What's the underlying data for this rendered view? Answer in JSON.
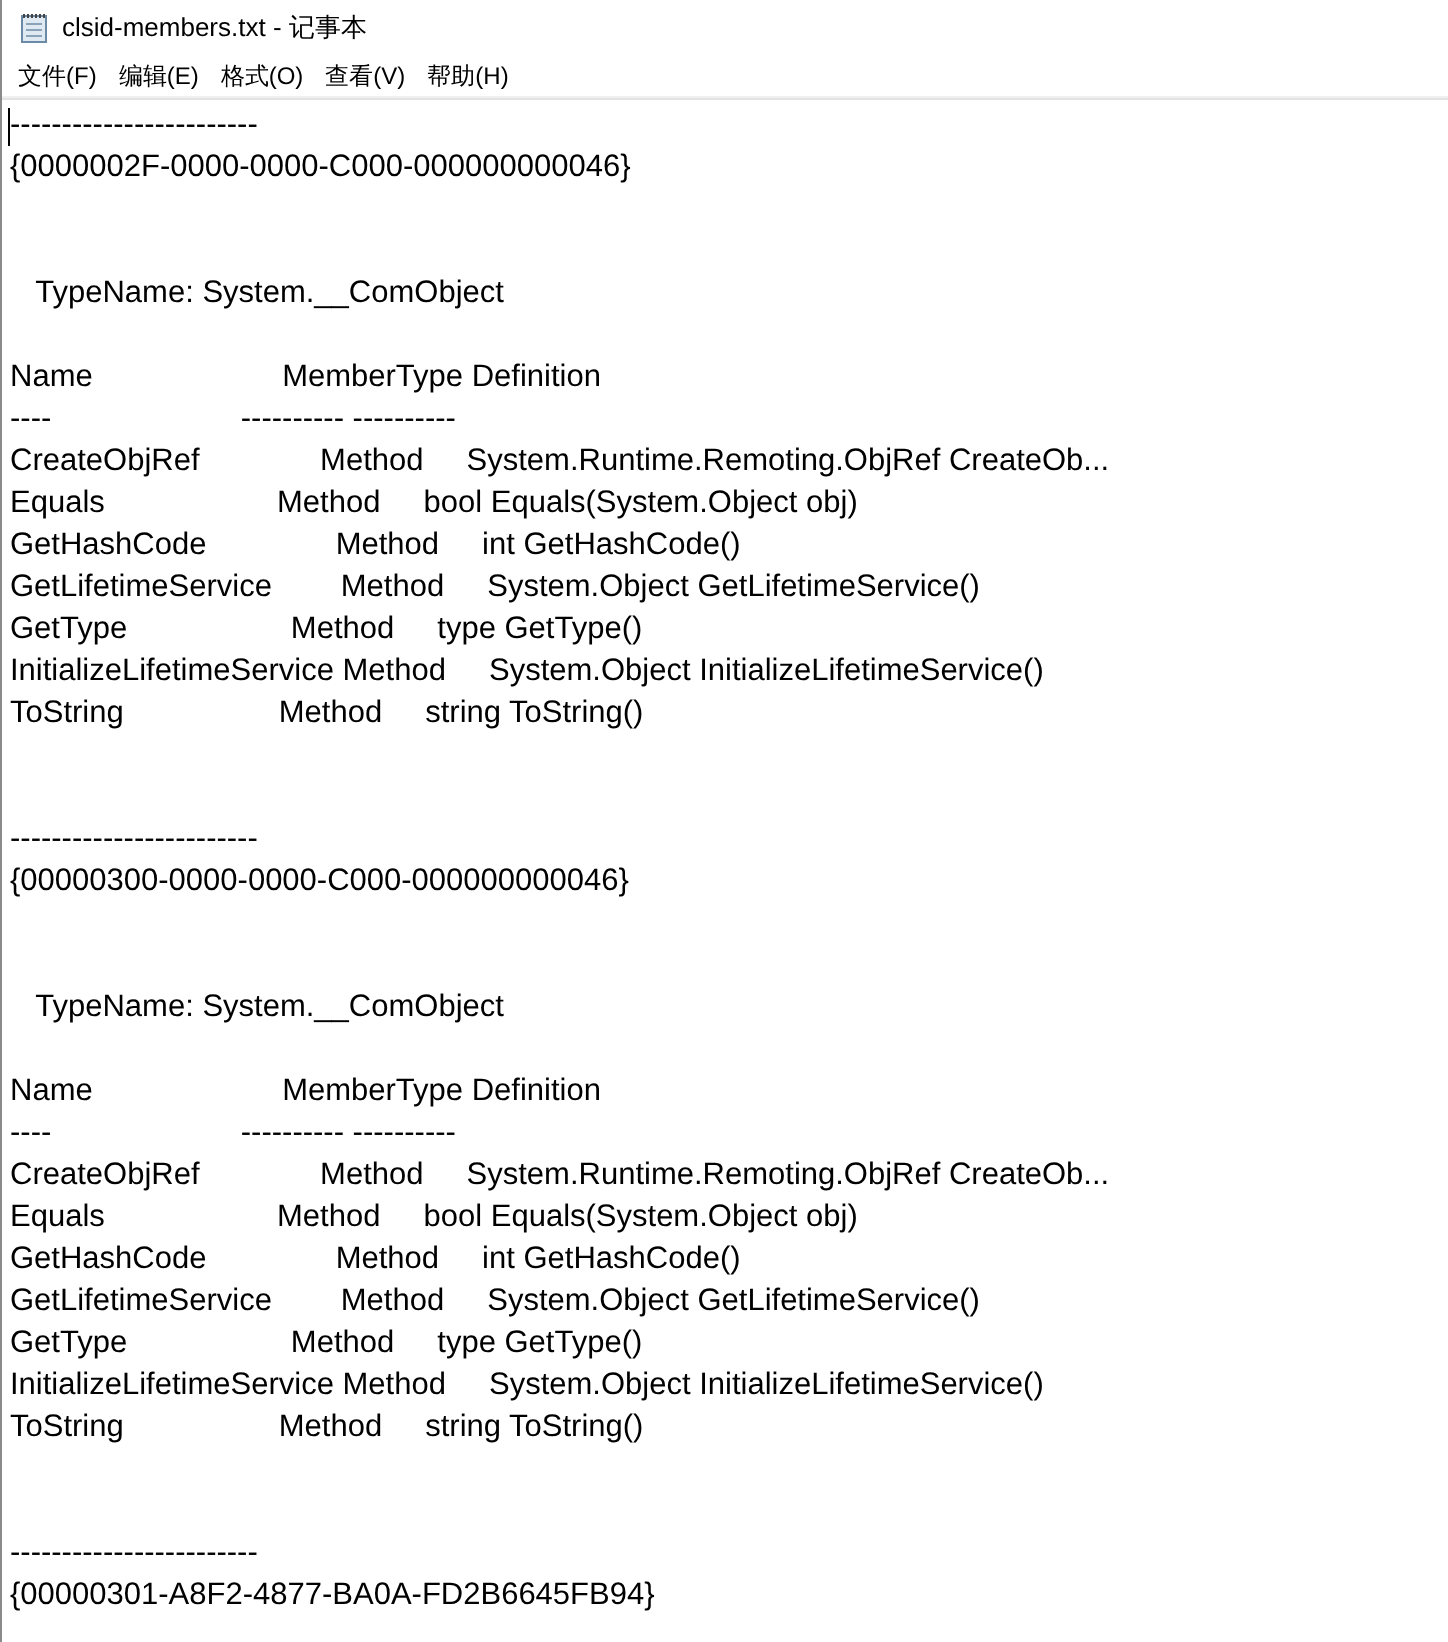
{
  "window": {
    "title": "clsid-members.txt - 记事本"
  },
  "menu": [
    "文件(F)",
    "编辑(E)",
    "格式(O)",
    "查看(V)",
    "帮助(H)"
  ],
  "blocks": [
    {
      "rule": "------------------------",
      "guid": "{0000002F-0000-0000-C000-000000000046}",
      "type_name": "   TypeName: System.__ComObject",
      "header": "Name                      MemberType Definition",
      "header_rule": "----                      ---------- ----------",
      "rows": [
        "CreateObjRef              Method     System.Runtime.Remoting.ObjRef CreateOb...",
        "Equals                    Method     bool Equals(System.Object obj)",
        "GetHashCode               Method     int GetHashCode()",
        "GetLifetimeService        Method     System.Object GetLifetimeService()",
        "GetType                   Method     type GetType()",
        "InitializeLifetimeService Method     System.Object InitializeLifetimeService()",
        "ToString                  Method     string ToString()"
      ]
    },
    {
      "rule": "------------------------",
      "guid": "{00000300-0000-0000-C000-000000000046}",
      "type_name": "   TypeName: System.__ComObject",
      "header": "Name                      MemberType Definition",
      "header_rule": "----                      ---------- ----------",
      "rows": [
        "CreateObjRef              Method     System.Runtime.Remoting.ObjRef CreateOb...",
        "Equals                    Method     bool Equals(System.Object obj)",
        "GetHashCode               Method     int GetHashCode()",
        "GetLifetimeService        Method     System.Object GetLifetimeService()",
        "GetType                   Method     type GetType()",
        "InitializeLifetimeService Method     System.Object InitializeLifetimeService()",
        "ToString                  Method     string ToString()"
      ]
    },
    {
      "rule": "------------------------",
      "guid": "{00000301-A8F2-4877-BA0A-FD2B6645FB94}"
    }
  ]
}
